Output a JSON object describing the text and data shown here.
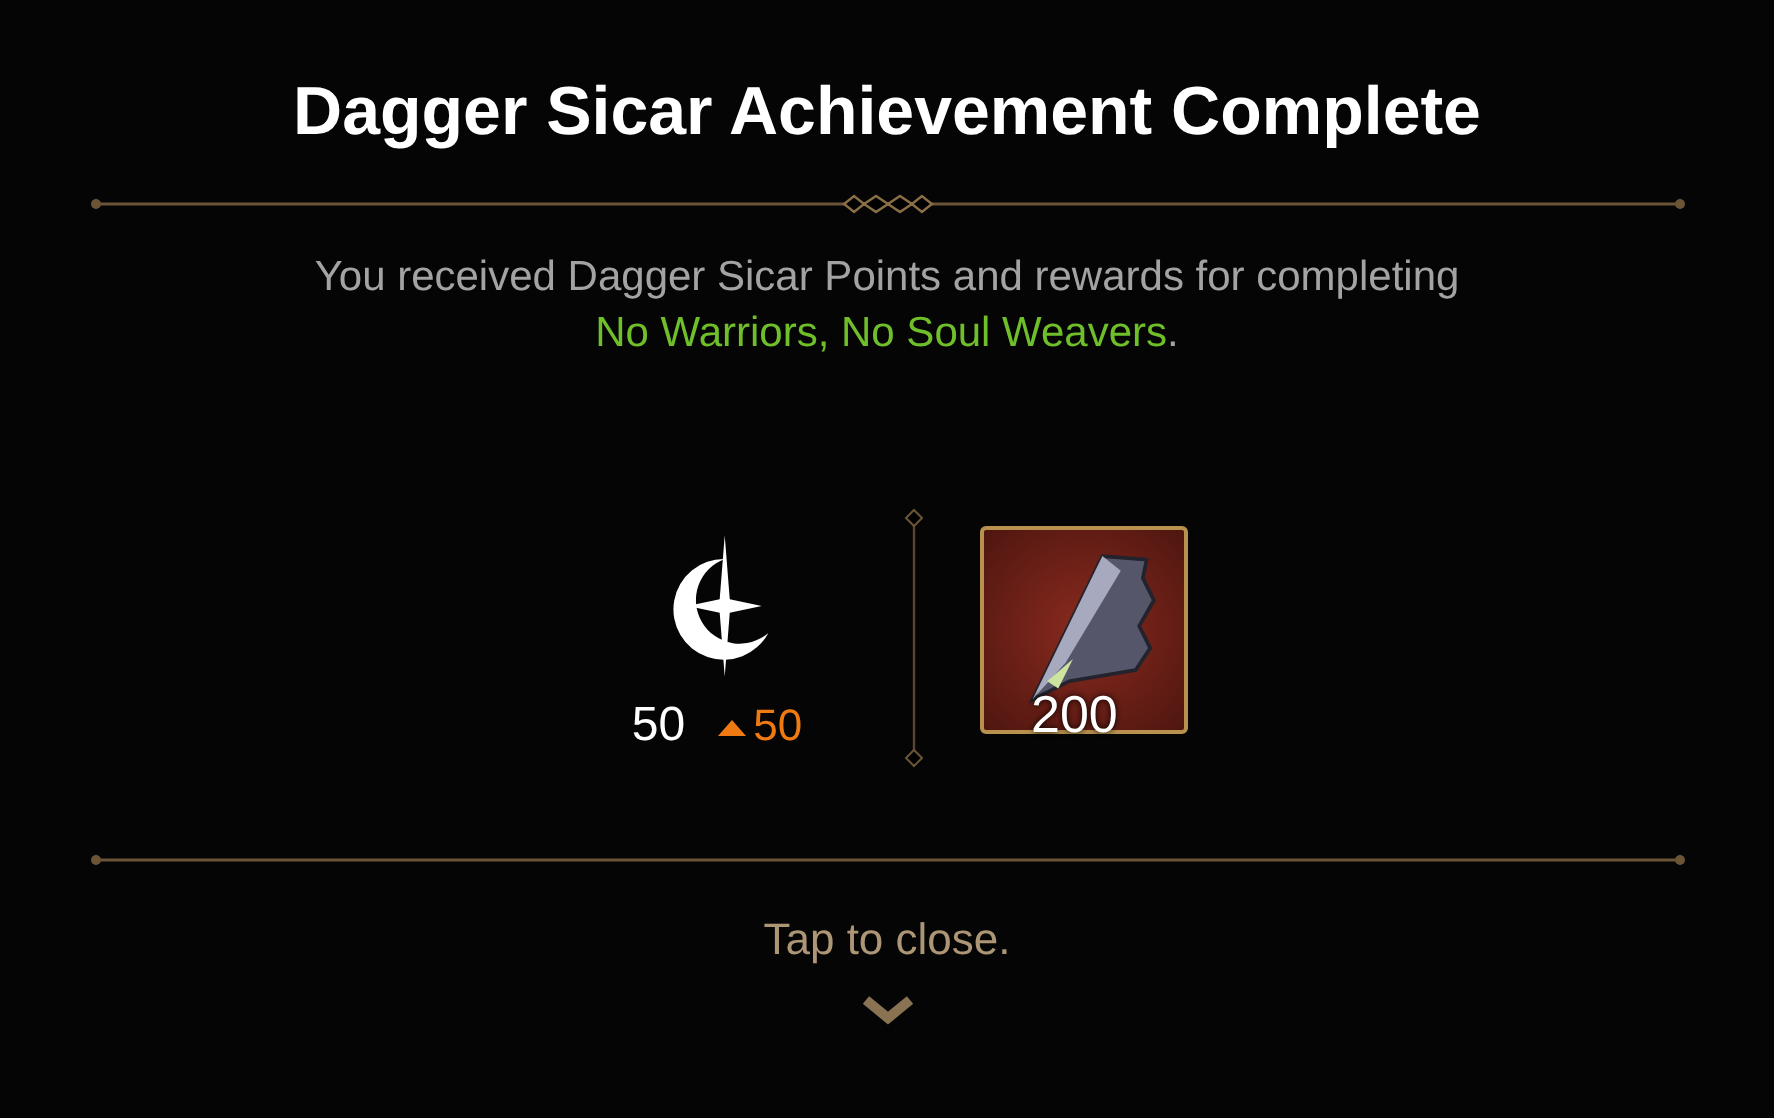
{
  "title": "Dagger Sicar Achievement Complete",
  "message": {
    "text": "You received Dagger Sicar Points and rewards for completing",
    "highlight": "No Warriors, No Soul Weavers",
    "suffix": "."
  },
  "points": {
    "value": "50",
    "increase": "50"
  },
  "reward": {
    "quantity": "200"
  },
  "footer": {
    "hint": "Tap to close."
  }
}
